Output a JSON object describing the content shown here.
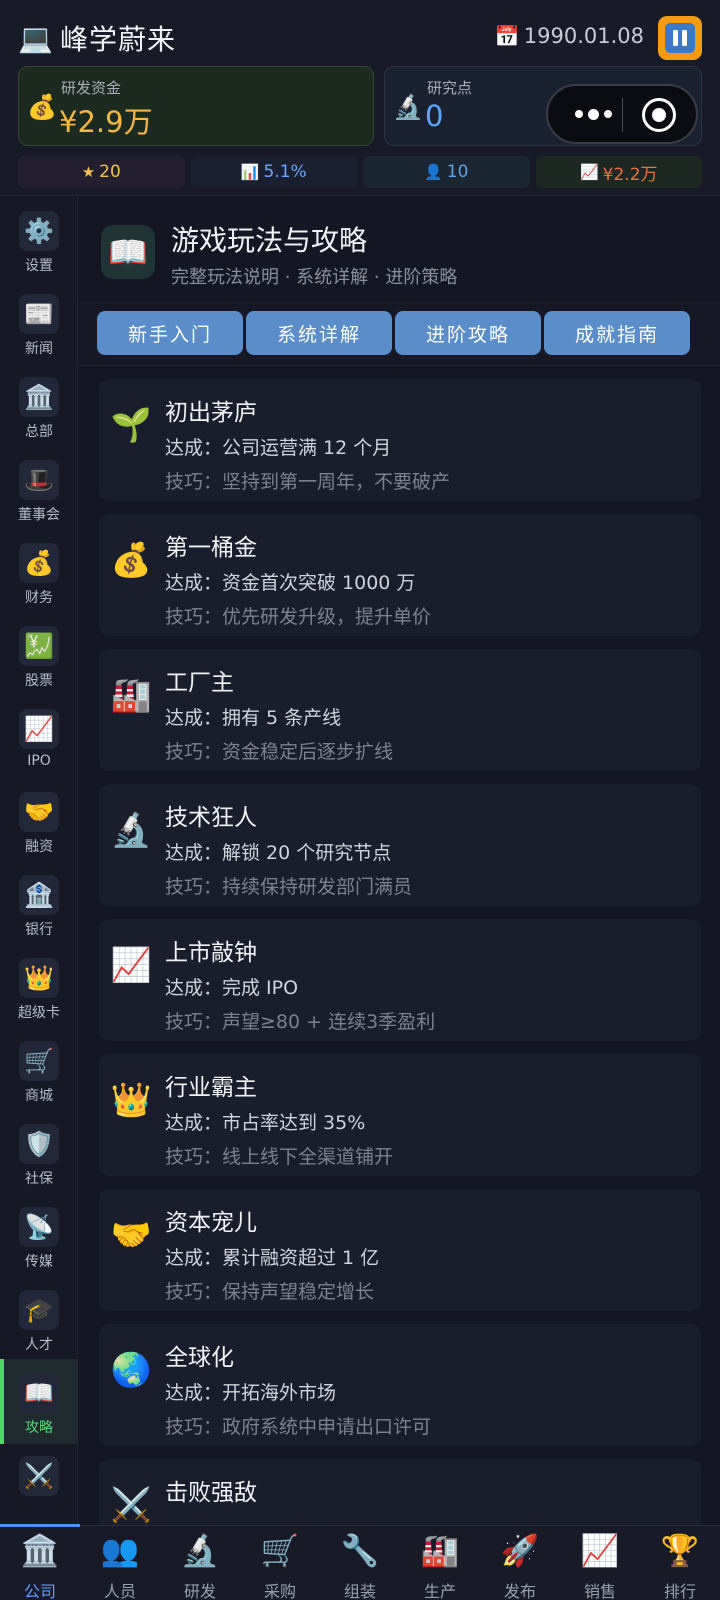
{
  "header": {
    "title": "峰学蔚来",
    "app_icon": "💻",
    "calendar_icon": "📅",
    "date": "1990.01.08"
  },
  "funds": {
    "icon": "💰",
    "label": "研发资金",
    "value": "¥2.9万"
  },
  "research": {
    "icon": "🔬",
    "label": "研究点",
    "value": "0"
  },
  "stats": [
    {
      "icon": "★",
      "value": "20"
    },
    {
      "icon": "📊",
      "value": "5.1%"
    },
    {
      "icon": "👤",
      "value": "10"
    },
    {
      "icon": "📈",
      "value": "¥2.2万"
    }
  ],
  "sidebar": [
    {
      "icon": "⚙️",
      "label": "设置"
    },
    {
      "icon": "📰",
      "label": "新闻"
    },
    {
      "icon": "🏛️",
      "label": "总部"
    },
    {
      "icon": "🎩",
      "label": "董事会"
    },
    {
      "icon": "💰",
      "label": "财务"
    },
    {
      "icon": "💹",
      "label": "股票"
    },
    {
      "icon": "📈",
      "label": "IPO"
    },
    {
      "icon": "🤝",
      "label": "融资"
    },
    {
      "icon": "🏦",
      "label": "银行"
    },
    {
      "icon": "👑",
      "label": "超级卡"
    },
    {
      "icon": "🛒",
      "label": "商城"
    },
    {
      "icon": "🛡️",
      "label": "社保"
    },
    {
      "icon": "📡",
      "label": "传媒"
    },
    {
      "icon": "🎓",
      "label": "人才"
    },
    {
      "icon": "📖",
      "label": "攻略"
    },
    {
      "icon": "⚔️",
      "label": ""
    }
  ],
  "guide": {
    "icon": "📖",
    "title": "游戏玩法与攻略",
    "subtitle": "完整玩法说明 · 系统详解 · 进阶策略",
    "tabs": [
      "新手入门",
      "系统详解",
      "进阶攻略",
      "成就指南"
    ]
  },
  "achievements": [
    {
      "icon": "🌱",
      "name": "初出茅庐",
      "reach": "达成：公司运营满 12 个月",
      "tip": "技巧：坚持到第一周年，不要破产"
    },
    {
      "icon": "💰",
      "name": "第一桶金",
      "reach": "达成：资金首次突破 1000 万",
      "tip": "技巧：优先研发升级，提升单价"
    },
    {
      "icon": "🏭",
      "name": "工厂主",
      "reach": "达成：拥有 5 条产线",
      "tip": "技巧：资金稳定后逐步扩线"
    },
    {
      "icon": "🔬",
      "name": "技术狂人",
      "reach": "达成：解锁 20 个研究节点",
      "tip": "技巧：持续保持研发部门满员"
    },
    {
      "icon": "📈",
      "name": "上市敲钟",
      "reach": "达成：完成 IPO",
      "tip": "技巧：声望≥80 + 连续3季盈利"
    },
    {
      "icon": "👑",
      "name": "行业霸主",
      "reach": "达成：市占率达到 35%",
      "tip": "技巧：线上线下全渠道铺开"
    },
    {
      "icon": "🤝",
      "name": "资本宠儿",
      "reach": "达成：累计融资超过 1 亿",
      "tip": "技巧：保持声望稳定增长"
    },
    {
      "icon": "🌏",
      "name": "全球化",
      "reach": "达成：开拓海外市场",
      "tip": "技巧：政府系统中申请出口许可"
    },
    {
      "icon": "⚔️",
      "name": "击败强敌",
      "reach": "",
      "tip": ""
    }
  ],
  "bottom_nav": [
    {
      "icon": "🏛️",
      "label": "公司"
    },
    {
      "icon": "👥",
      "label": "人员"
    },
    {
      "icon": "🔬",
      "label": "研发"
    },
    {
      "icon": "🛒",
      "label": "采购"
    },
    {
      "icon": "🔧",
      "label": "组装"
    },
    {
      "icon": "🏭",
      "label": "生产"
    },
    {
      "icon": "🚀",
      "label": "发布"
    },
    {
      "icon": "📈",
      "label": "销售"
    },
    {
      "icon": "🏆",
      "label": "排行"
    }
  ]
}
